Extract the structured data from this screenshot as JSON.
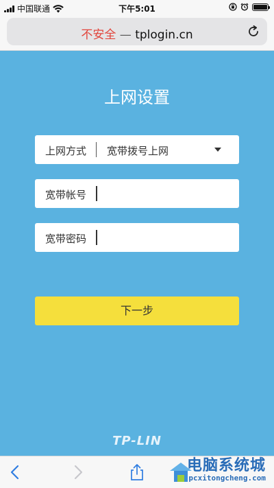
{
  "status_bar": {
    "carrier": "中国联通",
    "time": "下午5:01",
    "battery_level": 1.0
  },
  "browser": {
    "url_insecure_label": "不安全",
    "url_separator": "—",
    "url_host": "tplogin.cn",
    "reload_icon": "reload-icon"
  },
  "page": {
    "title": "上网设置",
    "fields": [
      {
        "label": "上网方式",
        "value": "宽带拨号上网",
        "type": "select"
      },
      {
        "label": "宽带帐号",
        "value": "",
        "type": "text"
      },
      {
        "label": "宽带密码",
        "value": "",
        "type": "password"
      }
    ],
    "next_button": "下一步",
    "brand": "TP-LIN"
  },
  "toolbar": {
    "icons": [
      "back-icon",
      "forward-icon",
      "share-icon",
      "bookmarks-icon",
      "tabs-icon"
    ]
  },
  "watermark": {
    "line1": "电脑系统城",
    "line2": "pcxitongcheng.com"
  },
  "colors": {
    "page_bg": "#5ab2e0",
    "button_bg": "#f5df3c",
    "insecure": "#e2453c"
  }
}
